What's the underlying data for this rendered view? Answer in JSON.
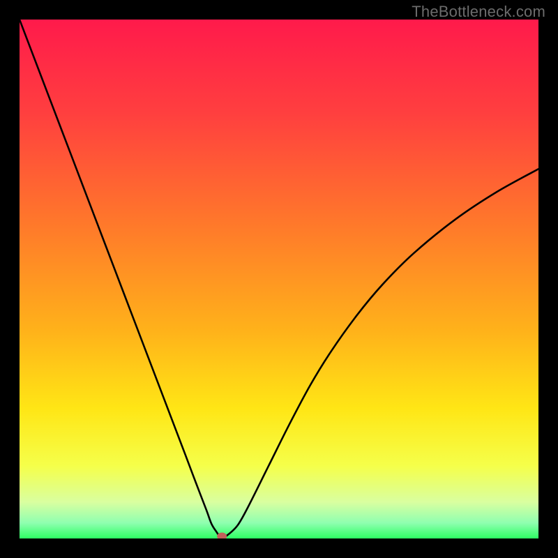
{
  "watermark": "TheBottleneck.com",
  "chart_data": {
    "type": "line",
    "title": "",
    "xlabel": "",
    "ylabel": "",
    "xlim": [
      0,
      100
    ],
    "ylim": [
      0,
      100
    ],
    "grid": false,
    "legend": false,
    "background_gradient": [
      "#ff1a4b",
      "#ffe615",
      "#2eff63"
    ],
    "series": [
      {
        "name": "bottleneck-curve",
        "x": [
          0,
          4,
          8,
          12,
          16,
          20,
          24,
          28,
          32,
          34,
          36,
          37,
          38,
          38.5,
          39,
          40,
          42,
          44,
          48,
          52,
          56,
          60,
          65,
          70,
          76,
          84,
          92,
          100
        ],
        "y": [
          100,
          89.5,
          79,
          68.5,
          58,
          47.5,
          37,
          26.5,
          16,
          10.7,
          5.5,
          2.8,
          1.2,
          0.5,
          0.2,
          0.6,
          2.5,
          6,
          14,
          22,
          29.5,
          36,
          43,
          49,
          55,
          61.5,
          66.8,
          71.2
        ]
      }
    ],
    "marker": {
      "x": 39,
      "y": 0.4
    }
  }
}
